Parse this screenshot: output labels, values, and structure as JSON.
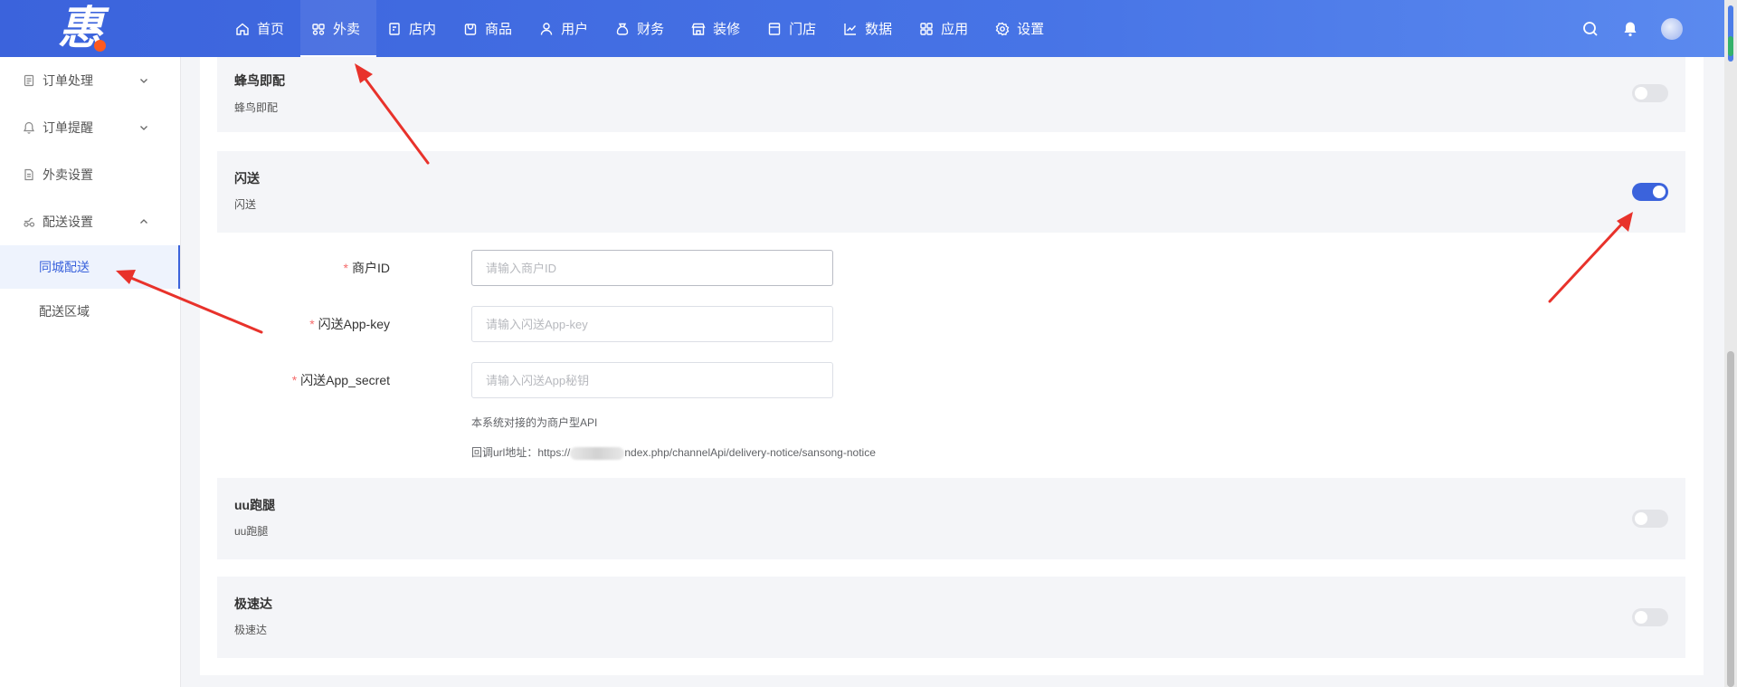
{
  "app": {
    "logo_text": "惠"
  },
  "nav": {
    "items": [
      {
        "label": "首页",
        "icon": "home-icon"
      },
      {
        "label": "外卖",
        "icon": "takeout-icon",
        "active": true
      },
      {
        "label": "店内",
        "icon": "store-inside-icon"
      },
      {
        "label": "商品",
        "icon": "goods-icon"
      },
      {
        "label": "用户",
        "icon": "user-icon"
      },
      {
        "label": "财务",
        "icon": "finance-icon"
      },
      {
        "label": "装修",
        "icon": "decor-icon"
      },
      {
        "label": "门店",
        "icon": "shop-icon"
      },
      {
        "label": "数据",
        "icon": "chart-icon"
      },
      {
        "label": "应用",
        "icon": "apps-icon"
      },
      {
        "label": "设置",
        "icon": "gear-icon"
      }
    ]
  },
  "sidebar": {
    "items": [
      {
        "label": "订单处理",
        "icon": "order-icon",
        "expand": "down"
      },
      {
        "label": "订单提醒",
        "icon": "bell-icon",
        "expand": "down"
      },
      {
        "label": "外卖设置",
        "icon": "doc-icon"
      },
      {
        "label": "配送设置",
        "icon": "delivery-icon",
        "expand": "up"
      }
    ],
    "subitems": [
      {
        "label": "同城配送",
        "active": true
      },
      {
        "label": "配送区域"
      }
    ]
  },
  "cards": {
    "fengniao": {
      "title": "蜂鸟即配",
      "desc": "蜂鸟即配",
      "enabled": false
    },
    "shansong": {
      "title": "闪送",
      "desc": "闪送",
      "enabled": true
    },
    "uu": {
      "title": "uu跑腿",
      "desc": "uu跑腿",
      "enabled": false
    },
    "jisuda": {
      "title": "极速达",
      "desc": "极速达",
      "enabled": false
    }
  },
  "form": {
    "required_mark": "*",
    "merchant_id": {
      "label": "商户ID",
      "placeholder": "请输入商户ID",
      "value": ""
    },
    "app_key": {
      "label": "闪送App-key",
      "placeholder": "请输入闪送App-key",
      "value": ""
    },
    "app_secret": {
      "label": "闪送App_secret",
      "placeholder": "请输入闪送App秘钥",
      "value": ""
    },
    "hint_api": "本系统对接的为商户型API",
    "hint_callback_prefix": "回调url地址：https://",
    "hint_callback_suffix": "ndex.php/channelApi/delivery-notice/sansong-notice"
  },
  "colors": {
    "primary": "#3b63dc",
    "annotation": "#e8322b"
  }
}
